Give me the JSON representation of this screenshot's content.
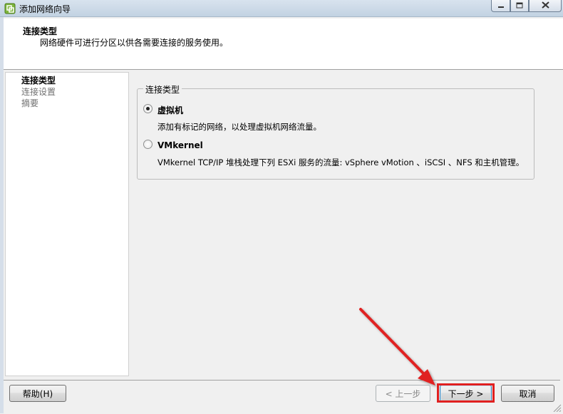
{
  "window": {
    "title": "添加网络向导"
  },
  "header": {
    "title": "连接类型",
    "subtitle": "网络硬件可进行分区以供各需要连接的服务使用。"
  },
  "nav": {
    "items": [
      {
        "label": "连接类型",
        "active": true
      },
      {
        "label": "连接设置",
        "active": false
      },
      {
        "label": "摘要",
        "active": false
      }
    ]
  },
  "group": {
    "legend": "连接类型",
    "options": [
      {
        "label": "虚拟机",
        "description": "添加有标记的网络，以处理虚拟机网络流量。",
        "selected": true
      },
      {
        "label": "VMkernel",
        "description": "VMkernel TCP/IP 堆栈处理下列 ESXi 服务的流量: vSphere vMotion 、iSCSI 、NFS 和主机管理。",
        "selected": false
      }
    ]
  },
  "footer": {
    "help_label": "帮助(H)",
    "back_label": "< 上一步",
    "next_label": "下一步 >",
    "cancel_label": "取消"
  },
  "annotation": {
    "color": "#e02020"
  }
}
